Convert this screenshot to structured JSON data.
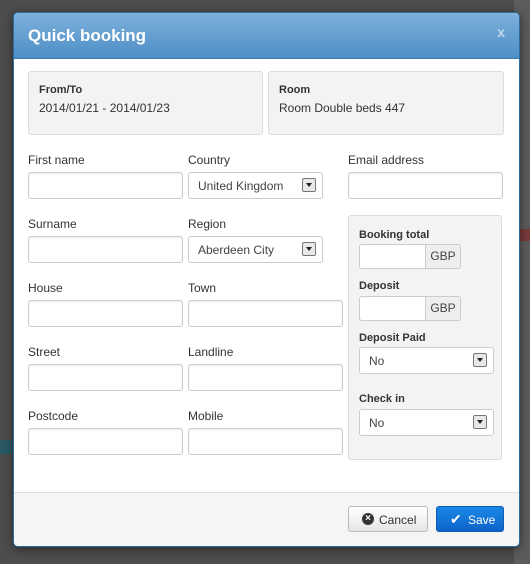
{
  "modal": {
    "title": "Quick booking",
    "close_label": "x"
  },
  "info": {
    "from_to_label": "From/To",
    "from_to_value": "2014/01/21 - 2014/01/23",
    "room_label": "Room",
    "room_value": "Room Double beds 447"
  },
  "form": {
    "first_name": {
      "label": "First name",
      "value": ""
    },
    "country": {
      "label": "Country",
      "value": "United Kingdom"
    },
    "email": {
      "label": "Email address",
      "value": ""
    },
    "surname": {
      "label": "Surname",
      "value": ""
    },
    "region": {
      "label": "Region",
      "value": "Aberdeen City"
    },
    "house": {
      "label": "House",
      "value": ""
    },
    "town": {
      "label": "Town",
      "value": ""
    },
    "street": {
      "label": "Street",
      "value": ""
    },
    "landline": {
      "label": "Landline",
      "value": ""
    },
    "postcode": {
      "label": "Postcode",
      "value": ""
    },
    "mobile": {
      "label": "Mobile",
      "value": ""
    }
  },
  "booking": {
    "total_label": "Booking total",
    "total_currency": "GBP",
    "deposit_label": "Deposit",
    "deposit_currency": "GBP",
    "deposit_paid_label": "Deposit Paid",
    "deposit_paid_value": "No",
    "checkin_label": "Check in",
    "checkin_value": "No"
  },
  "footer": {
    "cancel_label": "Cancel",
    "save_label": "Save"
  },
  "icons": {
    "cancel": "cancel-circle-icon",
    "save": "check-icon",
    "dropdown": "chevron-down-icon"
  },
  "colors": {
    "header": "#5a98cf",
    "primary": "#1278d8"
  }
}
